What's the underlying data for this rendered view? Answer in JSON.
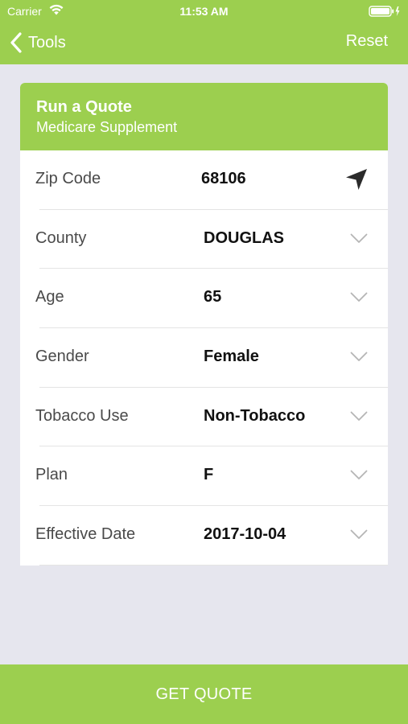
{
  "status_bar": {
    "carrier": "Carrier",
    "time": "11:53 AM"
  },
  "nav": {
    "back_label": "Tools",
    "reset_label": "Reset"
  },
  "card": {
    "title": "Run a Quote",
    "subtitle": "Medicare Supplement"
  },
  "form": {
    "zip": {
      "label": "Zip Code",
      "value": "68106"
    },
    "county": {
      "label": "County",
      "value": "DOUGLAS"
    },
    "age": {
      "label": "Age",
      "value": "65"
    },
    "gender": {
      "label": "Gender",
      "value": "Female"
    },
    "tobacco": {
      "label": "Tobacco Use",
      "value": "Non-Tobacco"
    },
    "plan": {
      "label": "Plan",
      "value": "F"
    },
    "effective_date": {
      "label": "Effective Date",
      "value": "2017-10-04"
    }
  },
  "footer": {
    "get_quote_label": "GET QUOTE"
  },
  "colors": {
    "accent_green": "#9ccf4f",
    "background": "#e6e6ee",
    "chevron_gray": "#b5b5b5"
  },
  "icons": {
    "wifi": "wifi-icon",
    "battery": "battery-icon",
    "back": "back-chevron-icon",
    "location": "location-arrow-icon",
    "dropdown": "chevron-down-icon"
  }
}
